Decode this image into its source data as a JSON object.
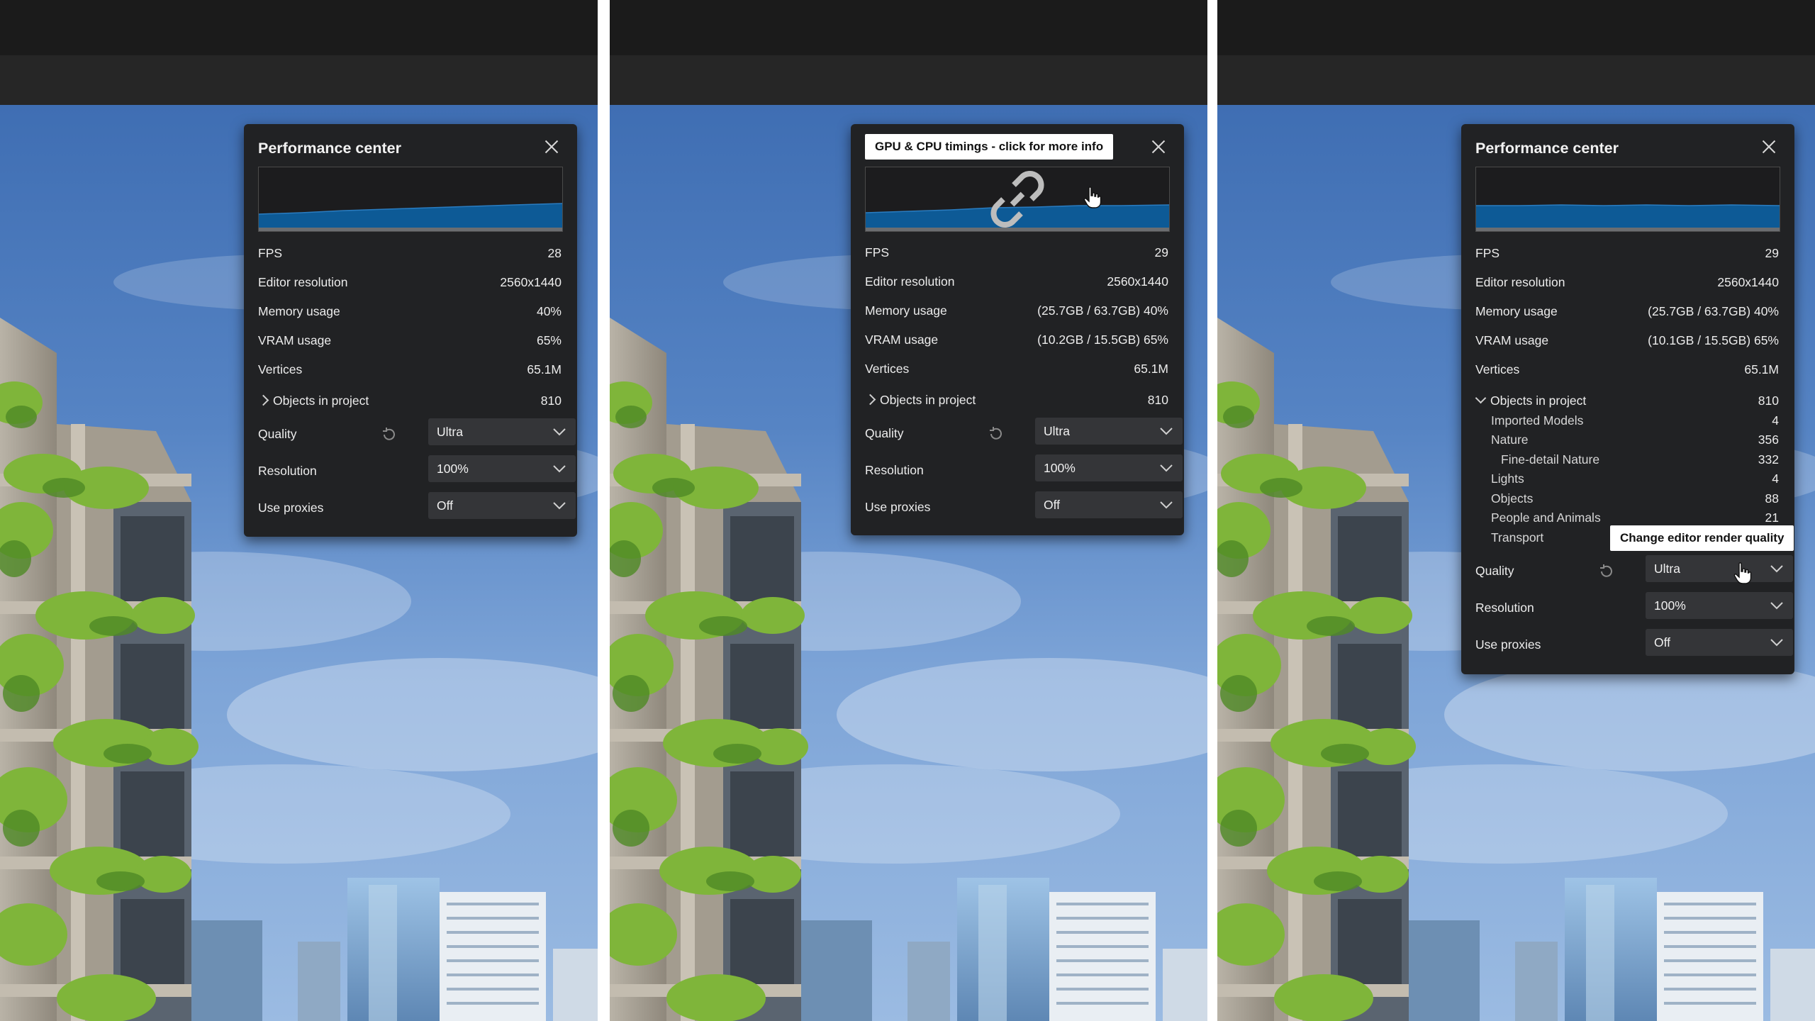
{
  "panes": [
    {
      "title": "Performance center",
      "stats": {
        "fps_label": "FPS",
        "fps": "28",
        "res_label": "Editor resolution",
        "res": "2560x1440",
        "mem_label": "Memory usage",
        "mem": "40%",
        "vram_label": "VRAM usage",
        "vram": "65%",
        "vert_label": "Vertices",
        "vert": "65.1M",
        "obj_label": "Objects in project",
        "obj": "810"
      },
      "controls": {
        "quality_label": "Quality",
        "quality": "Ultra",
        "resolution_label": "Resolution",
        "resolution": "100%",
        "proxies_label": "Use proxies",
        "proxies": "Off"
      },
      "objects_expanded": false
    },
    {
      "tooltip": "GPU & CPU timings - click for more info",
      "stats": {
        "fps_label": "FPS",
        "fps": "29",
        "res_label": "Editor resolution",
        "res": "2560x1440",
        "mem_label": "Memory usage",
        "mem": "(25.7GB / 63.7GB) 40%",
        "vram_label": "VRAM usage",
        "vram": "(10.2GB / 15.5GB) 65%",
        "vert_label": "Vertices",
        "vert": "65.1M",
        "obj_label": "Objects in project",
        "obj": "810"
      },
      "controls": {
        "quality_label": "Quality",
        "quality": "Ultra",
        "resolution_label": "Resolution",
        "resolution": "100%",
        "proxies_label": "Use proxies",
        "proxies": "Off"
      },
      "objects_expanded": false
    },
    {
      "title": "Performance center",
      "tooltip": "Change editor render quality",
      "stats": {
        "fps_label": "FPS",
        "fps": "29",
        "res_label": "Editor resolution",
        "res": "2560x1440",
        "mem_label": "Memory usage",
        "mem": "(25.7GB / 63.7GB) 40%",
        "vram_label": "VRAM usage",
        "vram": "(10.1GB / 15.5GB) 65%",
        "vert_label": "Vertices",
        "vert": "65.1M",
        "obj_label": "Objects in project",
        "obj": "810"
      },
      "categories": [
        {
          "label": "Imported Models",
          "count": "4"
        },
        {
          "label": "Nature",
          "count": "356"
        },
        {
          "label": "Fine-detail Nature",
          "count": "332"
        },
        {
          "label": "Lights",
          "count": "4"
        },
        {
          "label": "Objects",
          "count": "88"
        },
        {
          "label": "People and Animals",
          "count": "21"
        },
        {
          "label": "Transport",
          "count": ""
        }
      ],
      "controls": {
        "quality_label": "Quality",
        "quality": "Ultra",
        "resolution_label": "Resolution",
        "resolution": "100%",
        "proxies_label": "Use proxies",
        "proxies": "Off"
      },
      "objects_expanded": true
    }
  ],
  "graph_fill_color": "#0d5a96",
  "icons": [
    "close-icon",
    "link-icon",
    "chevron-right-icon",
    "chevron-down-icon",
    "reset-icon",
    "dropdown-arrow-icon",
    "hand-cursor-icon"
  ]
}
